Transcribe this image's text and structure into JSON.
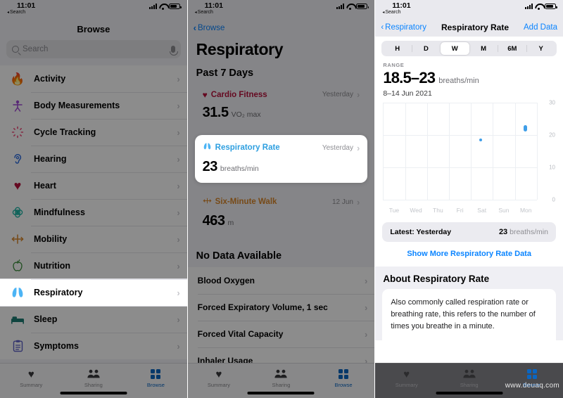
{
  "status_bar": {
    "time": "11:01",
    "back_label": "Search",
    "back_caret": "◂"
  },
  "screen1": {
    "nav_title": "Browse",
    "search": {
      "placeholder": "Search",
      "icon": "search-icon",
      "mic_icon": "microphone-icon"
    },
    "items": [
      {
        "label": "Activity",
        "icon": "flame-icon",
        "glyph": "🔥",
        "color": "#ff5a1f"
      },
      {
        "label": "Body Measurements",
        "icon": "body-icon",
        "glyph": "ᐅ",
        "color": "#a048d8"
      },
      {
        "label": "Cycle Tracking",
        "icon": "cycle-icon",
        "glyph": "✻",
        "color": "#f04c7a"
      },
      {
        "label": "Hearing",
        "icon": "ear-icon",
        "glyph": "ʑ",
        "color": "#2f6de0"
      },
      {
        "label": "Heart",
        "icon": "heart-icon",
        "glyph": "♥",
        "color": "#b8123c"
      },
      {
        "label": "Mindfulness",
        "icon": "mindfulness-icon",
        "glyph": "✿",
        "color": "#17b3a3"
      },
      {
        "label": "Mobility",
        "icon": "mobility-icon",
        "glyph": "⇄",
        "color": "#d9872a"
      },
      {
        "label": "Nutrition",
        "icon": "apple-icon",
        "glyph": "ⓐ",
        "color": "#3b8f3b"
      },
      {
        "label": "Respiratory",
        "icon": "lungs-icon",
        "glyph": "ᵜ",
        "color": "#4cb4f5"
      },
      {
        "label": "Sleep",
        "icon": "bed-icon",
        "glyph": "⏚",
        "color": "#1c7c74"
      },
      {
        "label": "Symptoms",
        "icon": "clipboard-icon",
        "glyph": "☰",
        "color": "#5c5fc7"
      }
    ],
    "highlight_label": "Respiratory",
    "chevron": "›"
  },
  "screen2": {
    "back_label": "Browse",
    "title": "Respiratory",
    "section_past7": "Past 7 Days",
    "cards": [
      {
        "name": "Cardio Fitness",
        "icon": "heart-icon",
        "color": "#b8123c",
        "when": "Yesterday",
        "value": "31.5",
        "unit": "VO₂ max",
        "highlighted": false
      },
      {
        "name": "Respiratory Rate",
        "icon": "lungs-icon",
        "color": "#4cb4f5",
        "when": "Yesterday",
        "value": "23",
        "unit": "breaths/min",
        "highlighted": true
      },
      {
        "name": "Six-Minute Walk",
        "icon": "walk-icon",
        "color": "#d9872a",
        "when": "12 Jun",
        "value": "463",
        "unit": "m",
        "highlighted": false
      }
    ],
    "section_nodata": "No Data Available",
    "nodata_items": [
      "Blood Oxygen",
      "Forced Expiratory Volume, 1 sec",
      "Forced Vital Capacity",
      "Inhaler Usage"
    ],
    "chevron": "›"
  },
  "screen3": {
    "back_label": "Respiratory",
    "title": "Respiratory Rate",
    "action_label": "Add Data",
    "segments": [
      "H",
      "D",
      "W",
      "M",
      "6M",
      "Y"
    ],
    "selected_segment": "W",
    "range_label": "RANGE",
    "range_value": "18.5–23",
    "range_unit": "breaths/min",
    "range_dates": "8–14 Jun 2021",
    "latest": {
      "label": "Latest: Yesterday",
      "value": "23",
      "unit": "breaths/min"
    },
    "show_more": "Show More Respiratory Rate Data",
    "about_title": "About Respiratory Rate",
    "about_text": "Also commonly called respiration rate or breathing rate, this refers to the number of times you breathe in a minute."
  },
  "tabbar": {
    "items": [
      {
        "label": "Summary",
        "icon": "heart-icon",
        "active": false
      },
      {
        "label": "Sharing",
        "icon": "people-icon",
        "active": false
      },
      {
        "label": "Browse",
        "icon": "grid-icon",
        "active": true
      }
    ]
  },
  "watermark": "www.deuaq.com",
  "colors": {
    "accent": "#0a84ff",
    "chart": "#3f9ee8",
    "tab_active": "#0a66c2"
  },
  "chart_data": {
    "type": "bar",
    "title": "Respiratory Rate",
    "xlabel": "",
    "ylabel": "breaths/min",
    "categories": [
      "Tue",
      "Wed",
      "Thu",
      "Fri",
      "Sat",
      "Sun",
      "Mon"
    ],
    "yticks": [
      0,
      10,
      20,
      30
    ],
    "ylim": [
      0,
      30
    ],
    "grid": true,
    "legend": "none",
    "series": [
      {
        "name": "Respiratory Rate range",
        "ranges": [
          null,
          null,
          null,
          null,
          [
            18.3,
            18.8
          ],
          null,
          [
            21.0,
            23.0
          ]
        ]
      }
    ],
    "annotations": {
      "range_text": "18.5–23 breaths/min",
      "date_range": "8–14 Jun 2021"
    }
  }
}
